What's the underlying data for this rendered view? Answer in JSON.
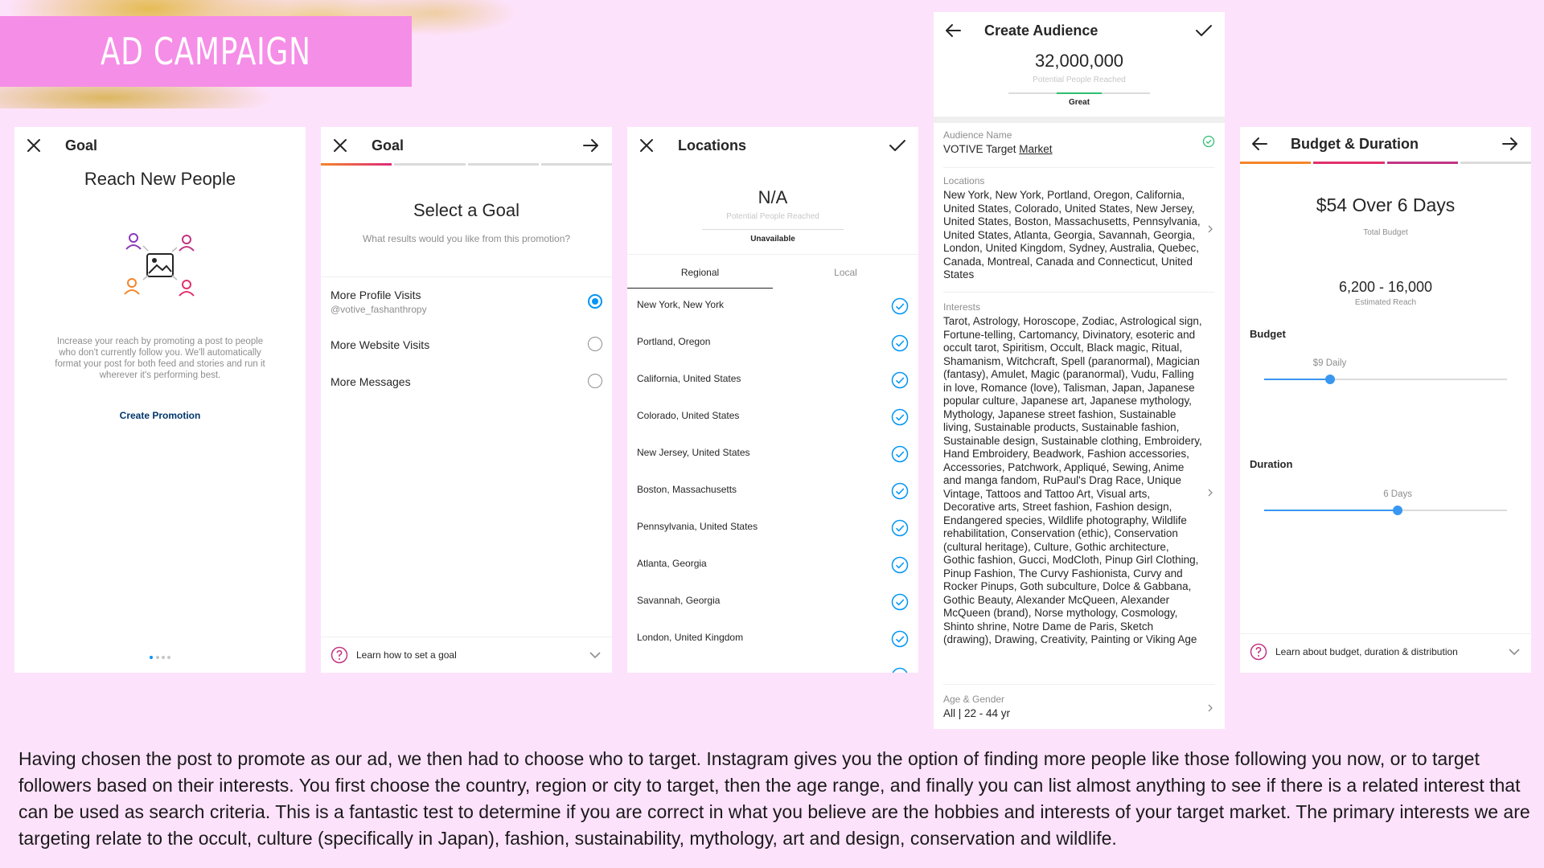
{
  "colors": {
    "pink": "#f58ee7",
    "background": "#fde2fb",
    "accent_blue": "#0095f6",
    "link_blue": "#00376b"
  },
  "heading": {
    "title": "AD CAMPAIGN"
  },
  "panel1": {
    "header_title": "Goal",
    "title": "Reach New People",
    "description": "Increase your reach by promoting a post to people who don't currently follow you. We'll automatically format your post for both feed and stories and run it wherever it's performing best.",
    "cta": "Create Promotion",
    "icons": {
      "close": "close-icon",
      "illustration": "people-image-icon"
    }
  },
  "panel2": {
    "header_title": "Goal",
    "title": "Select a Goal",
    "subtitle": "What results would you like from this promotion?",
    "options": [
      {
        "label": "More Profile Visits",
        "sub": "@votive_fashanthropy",
        "selected": true
      },
      {
        "label": "More Website Visits",
        "sub": "",
        "selected": false
      },
      {
        "label": "More Messages",
        "sub": "",
        "selected": false
      }
    ],
    "footer": "Learn how to set a goal"
  },
  "panel3": {
    "header_title": "Locations",
    "reach_value": "N/A",
    "reach_label": "Potential People Reached",
    "status": "Unavailable",
    "tabs": [
      "Regional",
      "Local"
    ],
    "locations": [
      "New York, New York",
      "Portland, Oregon",
      "California, United States",
      "Colorado, United States",
      "New Jersey, United States",
      "Boston, Massachusetts",
      "Pennsylvania, United States",
      "Atlanta, Georgia",
      "Savannah, Georgia",
      "London, United Kingdom"
    ]
  },
  "panel4": {
    "header_title": "Create Audience",
    "reach_value": "32,000,000",
    "reach_label": "Potential People Reached",
    "status": "Great",
    "name_label": "Audience Name",
    "name_value_prefix": "VOTIVE Target ",
    "name_value_underlined": "Market",
    "locations_label": "Locations",
    "locations_value": "New York, New York, Portland, Oregon, California, United States, Colorado, United States, New Jersey, United States, Boston, Massachusetts, Pennsylvania, United States, Atlanta, Georgia, Savannah, Georgia, London, United Kingdom, Sydney, Australia, Quebec, Canada, Montreal, Canada and Connecticut, United States",
    "interests_label": "Interests",
    "interests_value": "Tarot, Astrology, Horoscope, Zodiac, Astrological sign, Fortune-telling, Cartomancy, Divinatory, esoteric and occult tarot, Spiritism, Occult, Black magic, Ritual, Shamanism, Witchcraft, Spell (paranormal), Magician (fantasy), Amulet, Magic (paranormal), Vudu, Falling in love, Romance (love), Talisman, Japan, Japanese popular culture, Japanese art, Japanese mythology, Mythology, Japanese street fashion, Sustainable living, Sustainable products, Sustainable fashion, Sustainable design, Sustainable clothing, Embroidery, Hand Embroidery, Beadwork, Fashion accessories, Accessories, Patchwork, Appliqué, Sewing, Anime and manga fandom, RuPaul's Drag Race, Unique Vintage, Tattoos and Tattoo Art, Visual arts, Decorative arts, Street fashion, Fashion design, Endangered species, Wildlife photography, Wildlife rehabilitation, Conservation (ethic), Conservation (cultural heritage), Culture, Gothic architecture, Gothic fashion, Gucci, ModCloth, Pinup Girl Clothing, Pinup Fashion, The Curvy Fashionista, Curvy and Rocker Pinups, Goth subculture, Dolce & Gabbana, Gothic Beauty, Alexander McQueen, Alexander McQueen (brand), Norse mythology, Cosmology, Shinto shrine, Notre Dame de Paris, Sketch (drawing), Drawing, Creativity, Painting or Viking Age",
    "age_label": "Age & Gender",
    "age_value": "All | 22 - 44 yr"
  },
  "panel5": {
    "header_title": "Budget & Duration",
    "total_value": "$54 Over 6 Days",
    "total_label": "Total Budget",
    "reach_value": "6,200 - 16,000",
    "reach_label": "Estimated Reach",
    "budget_label": "Budget",
    "budget_value": "$9 Daily",
    "budget_fraction": 0.27,
    "duration_label": "Duration",
    "duration_value": "6 Days",
    "duration_fraction": 0.55,
    "footer": "Learn about budget, duration & distribution"
  },
  "description": "Having chosen the post to promote as our ad, we then had to choose who to target.  Instagram gives you the option of finding more people like those following you now, or to target followers based on their interests. You first choose the country, region or city to target, then the age range, and finally you can list almost anything to see if there is a related interest that can be used as search criteria.  This is a fantastic test to determine if you are correct in what you believe are the hobbies and interests of your target market.  The primary interests we are targeting relate to the occult, culture (specifically in Japan), fashion, sustainability, mythology, art and design, conservation and wildlife."
}
